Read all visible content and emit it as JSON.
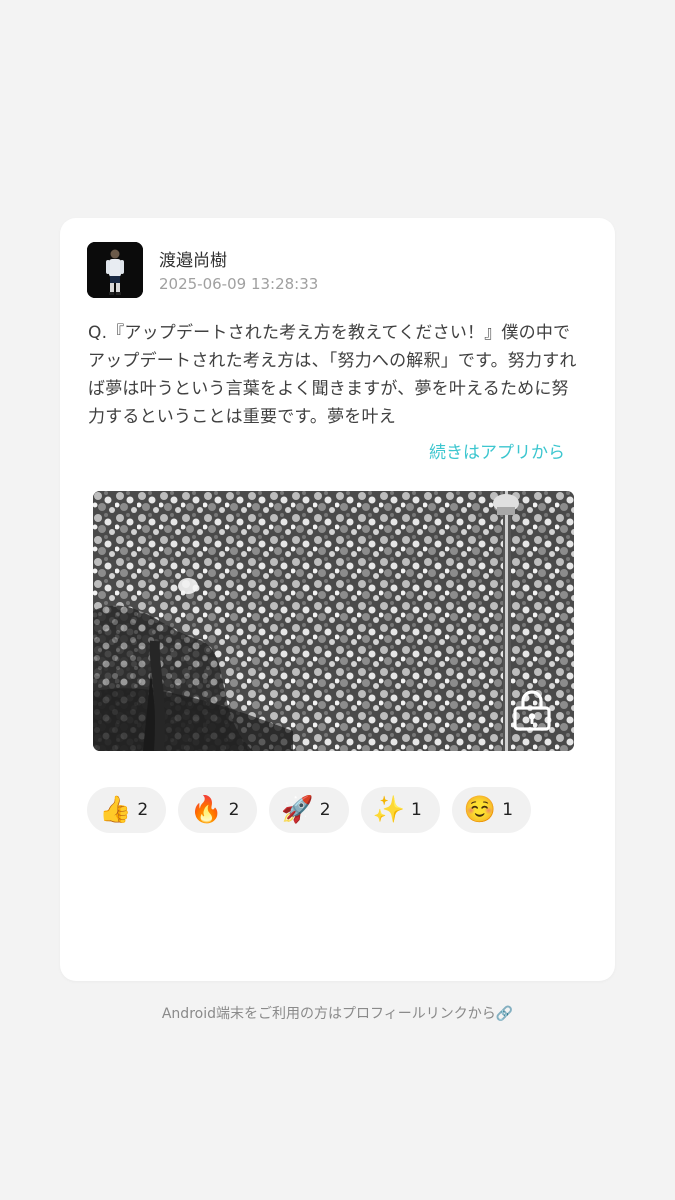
{
  "post": {
    "author": "渡邉尚樹",
    "timestamp": "2025-06-09 13:28:33",
    "text": "Q.『アップデートされた考え方を教えてください！』僕の中でアップデートされた考え方は、「努力への解釈」です。努力すれば夢は叶うという言葉をよく聞きますが、夢を叶えるために努力するということは重要です。夢を叶え",
    "read_more": "続きはアプリから",
    "image_icon": "lock-icon"
  },
  "reactions": [
    {
      "emoji": "👍",
      "icon": "thumbs-up-icon",
      "count": "2"
    },
    {
      "emoji": "🔥",
      "icon": "fire-icon",
      "count": "2"
    },
    {
      "emoji": "🚀",
      "icon": "rocket-icon",
      "count": "2"
    },
    {
      "emoji": "✨",
      "icon": "sparkles-icon",
      "count": "1"
    },
    {
      "emoji": "☺️",
      "icon": "smiling-face-icon",
      "count": "1"
    }
  ],
  "footer": "Android端末をご利用の方はプロフィールリンクから🔗",
  "colors": {
    "link": "#3cc6cf",
    "background": "#f3f3f3",
    "card": "#ffffff"
  }
}
